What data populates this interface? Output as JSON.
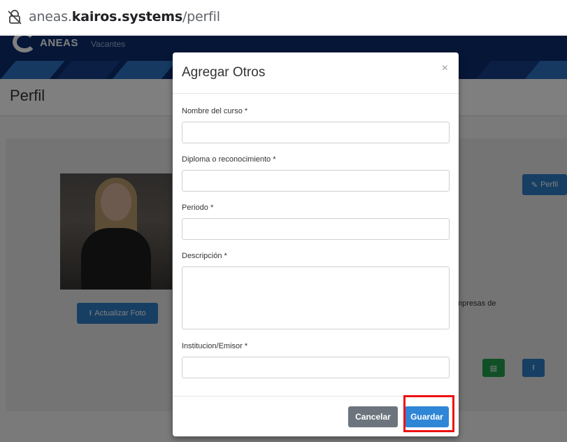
{
  "browser": {
    "url_prefix": "aneas.",
    "url_domain": "kairos.systems",
    "url_path": "/perfil"
  },
  "app": {
    "logo_text": "ANEAS",
    "nav_item": "Vacantes",
    "page_title": "Perfil"
  },
  "background": {
    "update_photo_label": "Actualizar Foto",
    "profile_button_label": "Perfil",
    "partial_text": "mpresas  de"
  },
  "modal": {
    "title": "Agregar Otros",
    "close_symbol": "×",
    "fields": {
      "course_name": {
        "label": "Nombre del curso *",
        "value": ""
      },
      "diploma": {
        "label": "Diploma o reconocimiento *",
        "value": ""
      },
      "period": {
        "label": "Periodo *",
        "value": ""
      },
      "description": {
        "label": "Descripción *",
        "value": ""
      },
      "institution": {
        "label": "Institucion/Emisor *",
        "value": ""
      }
    },
    "cancel_label": "Cancelar",
    "save_label": "Guardar"
  },
  "colors": {
    "navbar": "#0a2c6f",
    "primary": "#2f86d6",
    "secondary": "#6c757d",
    "success": "#23a04d",
    "highlight": "#ee1111"
  }
}
